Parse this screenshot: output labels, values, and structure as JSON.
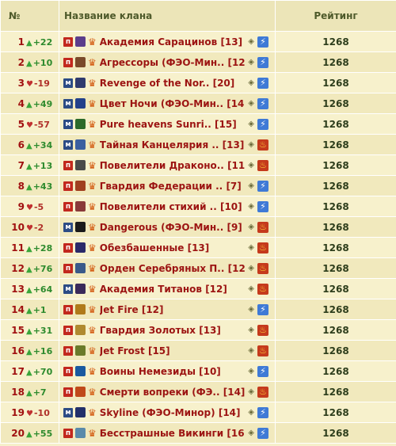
{
  "header": {
    "num": "№",
    "name": "Название клана",
    "rating": "Рейтинг"
  },
  "rows": [
    {
      "rank": "1",
      "dir": "up",
      "change": "+22",
      "mark": "п",
      "emblem_color": "#5b3e8c",
      "name": "Академия Сарацинов",
      "count": "[13]",
      "side": "lightning",
      "rating": "1268"
    },
    {
      "rank": "2",
      "dir": "up",
      "change": "+10",
      "mark": "п",
      "emblem_color": "#7a4a2a",
      "name": "Агрессоры (ФЭО-Мин..",
      "count": "[12]",
      "side": "lightning",
      "rating": "1268"
    },
    {
      "rank": "3",
      "dir": "down",
      "change": "-19",
      "mark": "м",
      "emblem_color": "#2f3b6e",
      "name": "Revenge of the Nor..",
      "count": "[20]",
      "side": "lightning",
      "rating": "1268"
    },
    {
      "rank": "4",
      "dir": "up",
      "change": "+49",
      "mark": "м",
      "emblem_color": "#22408a",
      "name": "Цвет Ночи (ФЭО-Мин..",
      "count": "[14]",
      "side": "lightning",
      "rating": "1268"
    },
    {
      "rank": "5",
      "dir": "down",
      "change": "-57",
      "mark": "м",
      "emblem_color": "#2c6a2a",
      "name": "Pure heavens Sunri..",
      "count": "[15]",
      "side": "lightning",
      "rating": "1268"
    },
    {
      "rank": "6",
      "dir": "up",
      "change": "+34",
      "mark": "м",
      "emblem_color": "#3b5fa0",
      "name": "Тайная Канцелярия ..",
      "count": "[13]",
      "side": "fire",
      "rating": "1268"
    },
    {
      "rank": "7",
      "dir": "up",
      "change": "+13",
      "mark": "п",
      "emblem_color": "#4a4a4a",
      "name": "Повелители Драконо..",
      "count": "[11]",
      "side": "fire",
      "rating": "1268"
    },
    {
      "rank": "8",
      "dir": "up",
      "change": "+43",
      "mark": "п",
      "emblem_color": "#a04020",
      "name": "Гвардия Федерации ..",
      "count": "[7]",
      "side": "lightning",
      "rating": "1268"
    },
    {
      "rank": "9",
      "dir": "down",
      "change": "-5",
      "mark": "п",
      "emblem_color": "#8a3a3a",
      "name": "Повелители стихий ..",
      "count": "[10]",
      "side": "lightning",
      "rating": "1268"
    },
    {
      "rank": "10",
      "dir": "down",
      "change": "-2",
      "mark": "м",
      "emblem_color": "#1a1a1a",
      "name": "Dangerous (ФЭО-Мин..",
      "count": "[9]",
      "side": "fire",
      "rating": "1268"
    },
    {
      "rank": "11",
      "dir": "up",
      "change": "+28",
      "mark": "п",
      "emblem_color": "#2a2a6a",
      "name": "Обезбашенные",
      "count": "[13]",
      "side": "fire",
      "rating": "1268"
    },
    {
      "rank": "12",
      "dir": "up",
      "change": "+76",
      "mark": "п",
      "emblem_color": "#3a5a8a",
      "name": "Орден Серебряных П..",
      "count": "[12]",
      "side": "fire",
      "rating": "1268"
    },
    {
      "rank": "13",
      "dir": "up",
      "change": "+64",
      "mark": "м",
      "emblem_color": "#3a2a5a",
      "name": "Академия Титанов",
      "count": "[12]",
      "side": "fire",
      "rating": "1268"
    },
    {
      "rank": "14",
      "dir": "up",
      "change": "+1",
      "mark": "п",
      "emblem_color": "#b07a1a",
      "name": "Jet Fire",
      "count": "[12]",
      "side": "lightning",
      "rating": "1268"
    },
    {
      "rank": "15",
      "dir": "up",
      "change": "+31",
      "mark": "п",
      "emblem_color": "#b08a30",
      "name": "Гвардия Золотых ",
      "count": "[13]",
      "side": "fire",
      "rating": "1268"
    },
    {
      "rank": "16",
      "dir": "up",
      "change": "+16",
      "mark": "п",
      "emblem_color": "#6a7a2a",
      "name": "Jet Frost",
      "count": "[15]",
      "side": "fire",
      "rating": "1268"
    },
    {
      "rank": "17",
      "dir": "up",
      "change": "+70",
      "mark": "п",
      "emblem_color": "#1a5aa0",
      "name": "Воины Немезиды",
      "count": "[10]",
      "side": "lightning",
      "rating": "1268"
    },
    {
      "rank": "18",
      "dir": "up",
      "change": "+7",
      "mark": "п",
      "emblem_color": "#c04a1a",
      "name": "Смерти вопреки (ФЭ..",
      "count": "[14]",
      "side": "fire",
      "rating": "1268"
    },
    {
      "rank": "19",
      "dir": "down",
      "change": "-10",
      "mark": "м",
      "emblem_color": "#22306a",
      "name": "Skyline (ФЭО-Минор)",
      "count": "[14]",
      "side": "lightning",
      "rating": "1268"
    },
    {
      "rank": "20",
      "dir": "up",
      "change": "+55",
      "mark": "п",
      "emblem_color": "#5a8aaa",
      "name": "Бесстрашные Викинги",
      "count": "[16]",
      "side": "lightning",
      "rating": "1268"
    }
  ]
}
